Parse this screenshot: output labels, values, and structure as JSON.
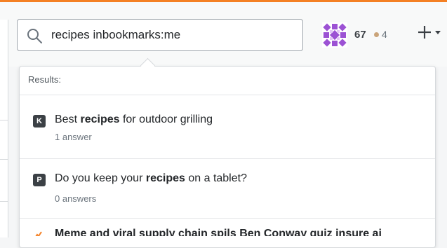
{
  "search": {
    "value": "recipes inbookmarks:me"
  },
  "user": {
    "reputation": "67",
    "bronze_badges": "4"
  },
  "results": {
    "label": "Results:",
    "items": [
      {
        "badge": "K",
        "title_before": "Best ",
        "title_match": "recipes",
        "title_after": " for outdoor grilling",
        "answers": "1 answer"
      },
      {
        "badge": "P",
        "title_before": "Do you keep your ",
        "title_match": "recipes",
        "title_after": " on a tablet?",
        "answers": "0 answers"
      }
    ],
    "cutoff_text": "Meme and viral supply chain spils Ben Conway quiz insure ai"
  },
  "colors": {
    "accent": "#f48024",
    "badge_bronze": "#caa47a"
  },
  "icons": [
    "search-icon",
    "avatar-identicon",
    "plus-icon",
    "caret-down-icon",
    "site-icon"
  ]
}
